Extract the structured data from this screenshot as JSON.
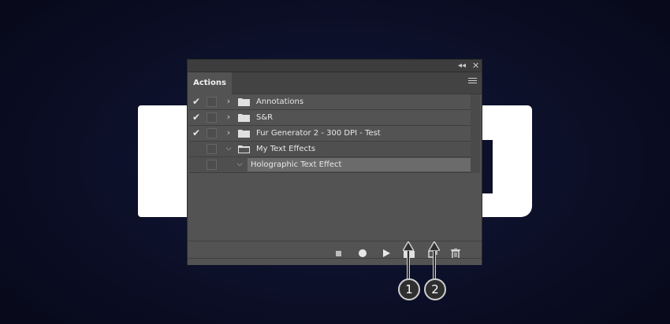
{
  "panel": {
    "tab_label": "Actions",
    "collapse_icon": "double-chevron-left-icon",
    "close_icon": "close-icon",
    "menu_icon": "hamburger-menu-icon"
  },
  "actions": [
    {
      "checked": true,
      "label": "Annotations",
      "expanded": false,
      "type": "set"
    },
    {
      "checked": true,
      "label": "S&R",
      "expanded": false,
      "type": "set"
    },
    {
      "checked": true,
      "label": "Fur Generator 2 - 300 DPI - Test",
      "expanded": false,
      "type": "set"
    },
    {
      "checked": false,
      "label": "My Text Effects",
      "expanded": true,
      "type": "set"
    },
    {
      "checked": false,
      "label": "Holographic Text Effect",
      "expanded": true,
      "type": "action",
      "selected": true
    }
  ],
  "toolbar": {
    "stop_icon": "stop-icon",
    "record_icon": "record-icon",
    "play_icon": "play-icon",
    "new_set_icon": "folder-icon",
    "new_action_icon": "new-item-icon",
    "delete_icon": "trash-icon"
  },
  "callouts": [
    "1",
    "2"
  ],
  "colors": {
    "background": "#0c1029",
    "panel": "#535353",
    "selection": "#6b6b6b"
  }
}
